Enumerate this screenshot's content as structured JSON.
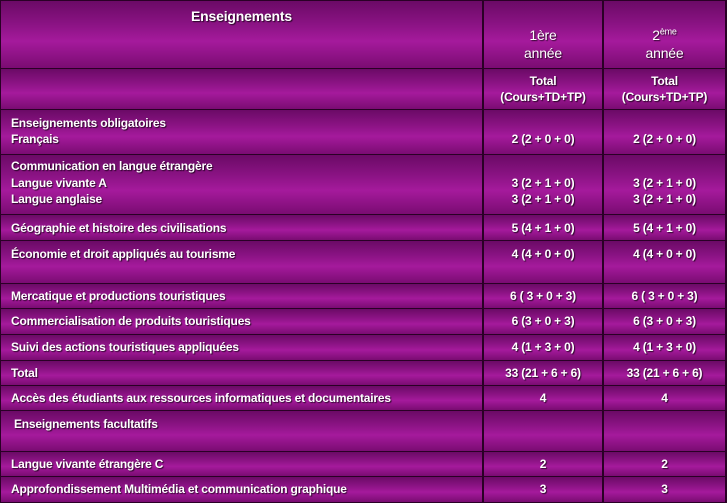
{
  "header": {
    "title": "Enseignements",
    "year1_line1": "1ère",
    "year1_line2": "année",
    "year2_num": "2",
    "year2_sup": "ème",
    "year2_line2": "année",
    "total_line1": "Total",
    "total_line2": "(Cours+TD+TP)"
  },
  "rows": [
    {
      "label1": "Enseignements obligatoires",
      "label2": "Français",
      "y1_1": "2 (2 + 0 + 0)",
      "y2_1": "2 (2 + 0 + 0)"
    },
    {
      "label1": "Communication en langue étrangère",
      "label2": "Langue vivante A",
      "label3": "Langue anglaise",
      "y1_1": "3 (2 + 1 + 0)",
      "y1_2": "3 (2 + 1 + 0)",
      "y2_1": "3 (2 + 1 + 0)",
      "y2_2": "3 (2 + 1 + 0)"
    },
    {
      "label1": "Géographie et histoire des civilisations",
      "y1_1": "5 (4 + 1 + 0)",
      "y2_1": "5 (4 + 1 + 0)"
    },
    {
      "label1": "Économie et droit appliqués au tourisme",
      "y1_1": "4 (4 + 0 + 0)",
      "y2_1": "4 (4 + 0 + 0)"
    },
    {
      "label1": "Mercatique et productions touristiques",
      "y1_1": "6 ( 3 + 0 + 3)",
      "y2_1": "6 ( 3 + 0 + 3)"
    },
    {
      "label1": "Commercialisation de produits touristiques",
      "y1_1": "6 (3 + 0 + 3)",
      "y2_1": "6 (3 + 0 + 3)"
    },
    {
      "label1": "Suivi des actions touristiques appliquées",
      "y1_1": "4 (1 + 3 + 0)",
      "y2_1": "4 (1 + 3 + 0)"
    },
    {
      "label1": "Total",
      "y1_1": "33 (21 + 6 + 6)",
      "y2_1": "33 (21 + 6 + 6)"
    },
    {
      "label1": "Accès des étudiants aux ressources informatiques et documentaires",
      "y1_1": "4",
      "y2_1": "4"
    },
    {
      "label1": "Enseignements facultatifs"
    },
    {
      "label1": "Langue vivante étrangère C",
      "y1_1": "2",
      "y2_1": "2"
    },
    {
      "label1": "Approfondissement Multimédia et communication graphique",
      "y1_1": "3",
      "y2_1": "3"
    }
  ]
}
